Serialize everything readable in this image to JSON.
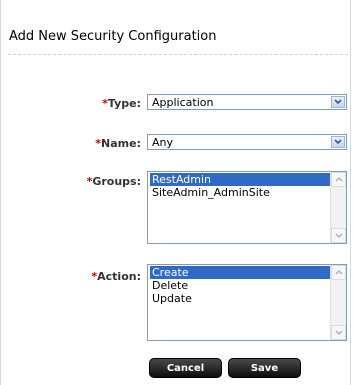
{
  "form": {
    "title": "Add New Security Configuration",
    "required_marker": "*",
    "type": {
      "label": "Type:",
      "value": "Application"
    },
    "name": {
      "label": "Name:",
      "value": "Any"
    },
    "groups": {
      "label": "Groups:",
      "options": [
        "RestAdmin",
        "SiteAdmin_AdminSite"
      ],
      "selected": "RestAdmin"
    },
    "action": {
      "label": "Action:",
      "options": [
        "Create",
        "Delete",
        "Update"
      ],
      "selected": "Create"
    }
  },
  "buttons": {
    "cancel": "Cancel",
    "save": "Save"
  }
}
